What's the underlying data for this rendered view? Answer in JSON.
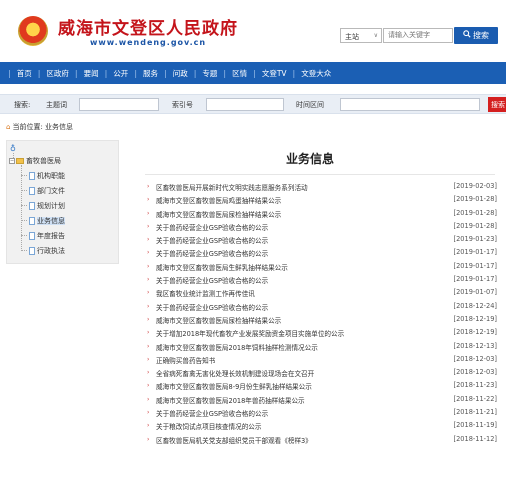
{
  "header": {
    "site_title": "威海市文登区人民政府",
    "site_url": "www.wendeng.gov.cn",
    "site_select": "主站",
    "search_placeholder": "请输入关键字",
    "search_button": "搜索"
  },
  "nav": {
    "items": [
      "首页",
      "区政府",
      "要闻",
      "公开",
      "服务",
      "问政",
      "专题",
      "区情",
      "文登TV",
      "文登大众"
    ]
  },
  "filter": {
    "search_label": "搜索:",
    "topic_label": "主题词",
    "index_label": "索引号",
    "time_label": "时间区间",
    "button": "搜索"
  },
  "breadcrumb": "当前位置: 业务信息",
  "sidebar": {
    "root": "畜牧兽医局",
    "items": [
      "机构职能",
      "部门文件",
      "规划计划",
      "业务信息",
      "年度报告",
      "行政执法"
    ],
    "selected_index": 3
  },
  "content": {
    "title": "业务信息",
    "rows": [
      {
        "title": "区畜牧兽医局开展新时代文明实践志愿服务系列活动",
        "date": "[2019-02-03]"
      },
      {
        "title": "威海市文登区畜牧兽医局鸡蛋抽样结果公示",
        "date": "[2019-01-28]"
      },
      {
        "title": "威海市文登区畜牧兽医局尿检抽样结果公示",
        "date": "[2019-01-28]"
      },
      {
        "title": "关于兽药经营企业GSP验收合格的公示",
        "date": "[2019-01-28]"
      },
      {
        "title": "关于兽药经营企业GSP验收合格的公示",
        "date": "[2019-01-23]"
      },
      {
        "title": "关于兽药经营企业GSP验收合格的公示",
        "date": "[2019-01-17]"
      },
      {
        "title": "威海市文登区畜牧兽医局生鲜乳抽样结果公示",
        "date": "[2019-01-17]"
      },
      {
        "title": "关于兽药经营企业GSP验收合格的公示",
        "date": "[2019-01-17]"
      },
      {
        "title": "我区畜牧业统计监测工作再传佳讯",
        "date": "[2019-01-07]"
      },
      {
        "title": "关于兽药经营企业GSP验收合格的公示",
        "date": "[2018-12-24]"
      },
      {
        "title": "威海市文登区畜牧兽医局尿检抽样结果公示",
        "date": "[2018-12-19]"
      },
      {
        "title": "关于增加2018年现代畜牧产业发展奖励资金项目实施单位的公示",
        "date": "[2018-12-19]"
      },
      {
        "title": "威海市文登区畜牧兽医局2018年饲料抽样检测情况公示",
        "date": "[2018-12-13]"
      },
      {
        "title": "正确购买兽药告知书",
        "date": "[2018-12-03]"
      },
      {
        "title": "全省病死畜禽无害化处理长效机制建设现场会在文召开",
        "date": "[2018-12-03]"
      },
      {
        "title": "威海市文登区畜牧兽医局8-9月份生鲜乳抽样结果公示",
        "date": "[2018-11-23]"
      },
      {
        "title": "威海市文登区畜牧兽医局2018年兽药抽样结果公示",
        "date": "[2018-11-22]"
      },
      {
        "title": "关于兽药经营企业GSP验收合格的公示",
        "date": "[2018-11-21]"
      },
      {
        "title": "关于粮改饲试点项目核查情况的公示",
        "date": "[2018-11-19]"
      },
      {
        "title": "区畜牧兽医局机关党支部组织党员干部观看《榜样3》",
        "date": "[2018-11-12]"
      }
    ]
  },
  "colors": {
    "brand_red": "#c4141b",
    "nav_blue": "#1b5fb4",
    "button_blue": "#1a5cb0",
    "filter_button_red": "#d41f1f"
  }
}
